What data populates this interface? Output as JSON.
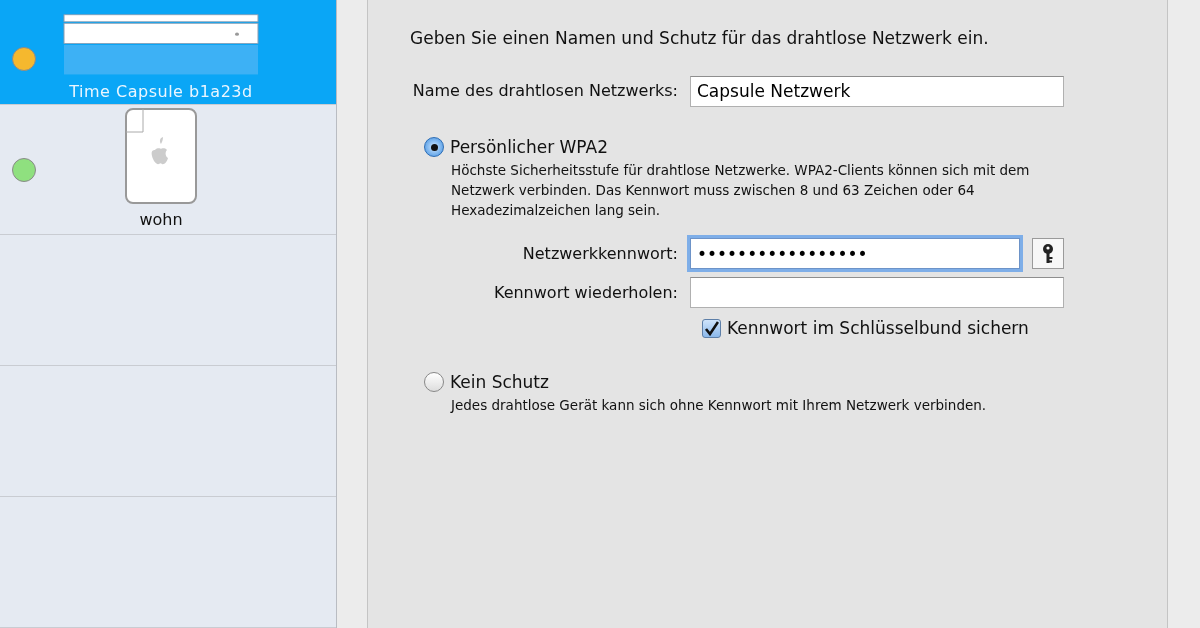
{
  "devices": [
    {
      "name": "Time Capsule b1a23d",
      "kind": "time-capsule",
      "color": "#f5b82e",
      "selected": true
    },
    {
      "name": "wohn",
      "kind": "airport-express",
      "color": "#8fe07f",
      "selected": false
    }
  ],
  "heading": "Geben Sie einen Namen und Schutz für das drahtlose Netzwerk ein.",
  "network_name": {
    "label": "Name des drahtlosen Netzwerks:",
    "value": "Capsule Netzwerk"
  },
  "security_options": [
    {
      "label": "Persönlicher WPA2",
      "description": "Höchste Sicherheitsstufe für drahtlose Netzwerke. WPA2-Clients können sich mit dem Netzwerk verbinden. Das Kennwort muss zwischen 8 und 63 Zeichen oder 64 Hexadezimalzeichen lang sein.",
      "selected": true,
      "password": {
        "label": "Netzwerkkennwort:",
        "value": "•••••••••••••••••",
        "focused": true
      },
      "repeat": {
        "label": "Kennwort wiederholen:"
      },
      "keychain": {
        "label": "Kennwort im Schlüsselbund sichern",
        "checked": true
      }
    },
    {
      "label": "Kein Schutz",
      "description": "Jedes drahtlose Gerät kann sich ohne Kennwort mit Ihrem Netzwerk verbinden.",
      "selected": false
    }
  ]
}
